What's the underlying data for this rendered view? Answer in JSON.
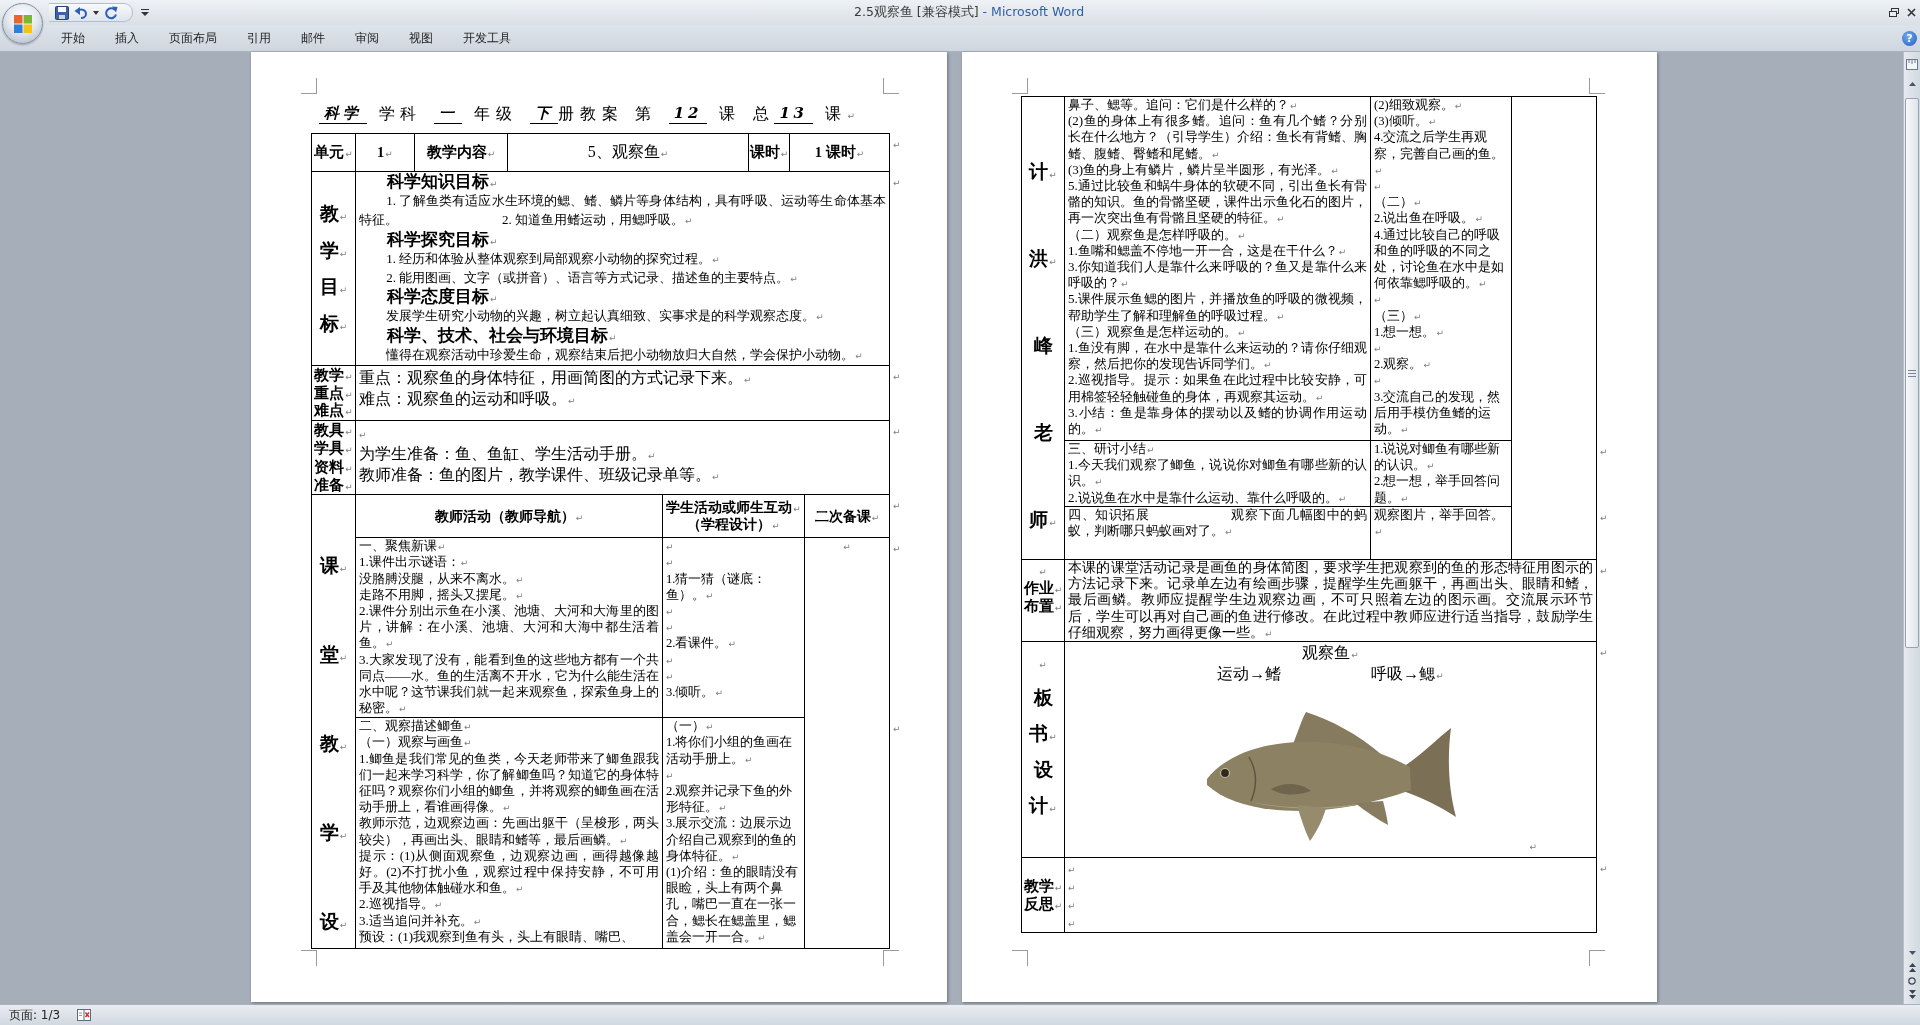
{
  "window": {
    "title": {
      "document": "2.5观察鱼 [兼容模式]",
      "separator": "-",
      "app": "Microsoft Word"
    }
  },
  "ribbon_tabs": [
    {
      "label": "开始",
      "selected": false
    },
    {
      "label": "插入",
      "selected": false
    },
    {
      "label": "页面布局",
      "selected": false
    },
    {
      "label": "引用",
      "selected": false
    },
    {
      "label": "邮件",
      "selected": false
    },
    {
      "label": "审阅",
      "selected": false
    },
    {
      "label": "视图",
      "selected": false
    },
    {
      "label": "开发工具",
      "selected": false
    }
  ],
  "help": {
    "label": "?"
  },
  "left_page": {
    "heading": [
      [
        {
          "text": "科学",
          "kind": "filled"
        }
      ],
      [
        {
          "text": "学科",
          "kind": "label"
        }
      ],
      [
        {
          "text": "一",
          "kind": "filled"
        }
      ],
      [
        {
          "text": "年级",
          "kind": "label"
        }
      ],
      [
        {
          "text": "下",
          "kind": "filled"
        },
        {
          "text": "册教案",
          "kind": "label"
        }
      ],
      [
        {
          "text": "第",
          "kind": "label"
        }
      ],
      [
        {
          "text": "12",
          "kind": "filled"
        }
      ],
      [
        {
          "text": "课",
          "kind": "label"
        }
      ],
      [
        {
          "text": "总",
          "kind": "label"
        },
        {
          "text": "13",
          "kind": "filled"
        }
      ],
      [
        {
          "text": "课",
          "kind": "label",
          "mark": "↵"
        }
      ]
    ],
    "table": {
      "info": {
        "cells": [
          {
            "text": "单元",
            "mark": "↵",
            "kind": "bold"
          },
          {
            "text": "1",
            "mark": "↵",
            "kind": "bold"
          },
          {
            "text": "教学内容",
            "mark": "↵",
            "kind": "bold"
          },
          {
            "text": "5、观察鱼",
            "mark": "↵",
            "kind": "plain"
          },
          {
            "text": "课时",
            "mark": "↵",
            "kind": "bold"
          },
          {
            "text": "1 课时",
            "mark": "↵",
            "kind": "bold"
          }
        ],
        "row_mark": "↵"
      },
      "objectives": {
        "label": [
          {
            "text": "教",
            "mark": "↵"
          },
          {
            "text": "学",
            "mark": "↵"
          },
          {
            "text": "目",
            "mark": "↵"
          },
          {
            "text": "标",
            "mark": "↵"
          }
        ],
        "content": [
          {
            "kind": "heading",
            "text": "科学知识目标",
            "mark": "↵"
          },
          {
            "kind": "body",
            "text": "1. 了解鱼类有适应水生环境的鳃、鳍、鳞片等身体结构，具有呼吸、运动等生命体基本特征。　　　　　　　　2. 知道鱼用鳍运动，用鳃呼吸。",
            "mark": "↵"
          },
          {
            "kind": "heading",
            "text": "科学探究目标",
            "mark": "↵"
          },
          {
            "kind": "body",
            "text": "1. 经历和体验从整体观察到局部观察小动物的探究过程。",
            "mark": "↵"
          },
          {
            "kind": "body",
            "text": "2. 能用图画、文字（或拼音）、语言等方式记录、描述鱼的主要特点。",
            "mark": "↵"
          },
          {
            "kind": "heading",
            "text": "科学态度目标",
            "mark": "↵"
          },
          {
            "kind": "body",
            "text": "发展学生研究小动物的兴趣，树立起认真细致、实事求是的科学观察态度。",
            "mark": "↵"
          },
          {
            "kind": "heading",
            "text": "科学、技术、社会与环境目标",
            "mark": "↵"
          },
          {
            "kind": "body",
            "text": "懂得在观察活动中珍爱生命，观察结束后把小动物放归大自然，学会保护小动物。",
            "mark": "↵"
          }
        ],
        "row_mark": "↵"
      },
      "key_points": {
        "label": [
          {
            "text": "教学",
            "mark": "↵"
          },
          {
            "text": "重点",
            "mark": "↵"
          },
          {
            "text": "难点",
            "mark": "↵"
          }
        ],
        "content": [
          {
            "text": "重点：观察鱼的身体特征，用画简图的方式记录下来。",
            "mark": "↵"
          },
          {
            "text": "难点：观察鱼的运动和呼吸。",
            "mark": "↵"
          }
        ],
        "row_mark": "↵"
      },
      "materials": {
        "label": [
          {
            "text": "教具",
            "mark": "↵"
          },
          {
            "text": "学具",
            "mark": "↵"
          },
          {
            "text": "资料",
            "mark": "↵"
          },
          {
            "text": "准备",
            "mark": "↵"
          }
        ],
        "content": [
          {
            "mark": "↵"
          },
          {
            "text": "为学生准备：鱼、鱼缸、学生活动手册。",
            "mark": "↵"
          },
          {
            "text": "教师准备：鱼的图片，教学课件、班级记录单等。",
            "mark": "↵"
          }
        ],
        "row_mark": "↵"
      },
      "activities": {
        "label": [
          {
            "text": "课",
            "mark": "↵"
          },
          {
            "text": "堂",
            "mark": "↵"
          },
          {
            "text": "教",
            "mark": "↵"
          },
          {
            "text": "学",
            "mark": "↵"
          },
          {
            "text": "设",
            "mark": "↵"
          }
        ],
        "columns": [
          [
            {
              "text": "教师活动（教师导航）",
              "mark": "↵"
            }
          ],
          [
            {
              "text": "学生活动或师生互动",
              "mark": "↵"
            },
            {
              "text": "（学程设计）",
              "mark": "↵"
            }
          ],
          [
            {
              "text": "二次备课",
              "mark": "↵"
            }
          ]
        ],
        "header_mark": "↵",
        "rows": [
          {
            "teacher": [
              {
                "text": "一、聚焦新课",
                "mark": "↵"
              },
              {
                "text": "1.课件出示谜语：",
                "mark": "↵"
              },
              {
                "text": "没胳膊没腿，从来不离水。",
                "mark": "↵"
              },
              {
                "text": "走路不用脚，摇头又摆尾。",
                "mark": "↵"
              },
              {
                "text": "2.课件分别出示鱼在小溪、池塘、大河和大海里的图片，讲解：在小溪、池塘、大河和大海中都生活着鱼。",
                "mark": "↵"
              },
              {
                "text": "3.大家发现了没有，能看到鱼的这些地方都有一个共同点——水。鱼的生活离不开水，它为什么能生活在水中呢？这节课我们就一起来观察鱼，探索鱼身上的秘密。",
                "mark": "↵"
              }
            ],
            "student": [
              {
                "mark": "↵"
              },
              {
                "mark": "↵"
              },
              {
                "text": "1.猜一猜（谜底：鱼）。",
                "mark": "↵"
              },
              {
                "mark": "↵"
              },
              {
                "mark": "↵"
              },
              {
                "text": "2.看课件。",
                "mark": "↵"
              },
              {
                "mark": "↵"
              },
              {
                "mark": "↵"
              },
              {
                "text": "3.倾听。",
                "mark": "↵"
              }
            ],
            "row_mark": "↵"
          },
          {
            "teacher": [
              {
                "text": "二、观察描述鲫鱼",
                "mark": "↵"
              },
              {
                "text": "（一）观察与画鱼",
                "mark": "↵"
              },
              {
                "text": "1.鲫鱼是我们常见的鱼类，今天老师带来了鲫鱼跟我们一起来学习科学，你了解鲫鱼吗？知道它的身体特征吗？观察你们小组的鲫鱼，并将观察的鲫鱼画在活动手册上，看谁画得像。",
                "mark": "↵"
              },
              {
                "text": "教师示范，边观察边画：先画出躯干（呈梭形，两头较尖），再画出头、眼睛和鳍等，最后画鳞。",
                "mark": "↵"
              },
              {
                "text": "提示：(1)从侧面观察鱼，边观察边画，画得越像越好。(2)不打扰小鱼，观察过程中保持安静，不可用手及其他物体触碰水和鱼。",
                "mark": "↵"
              },
              {
                "text": "2.巡视指导。",
                "mark": "↵"
              },
              {
                "text": "3.适当追问并补充。",
                "mark": "↵"
              },
              {
                "text": "预设：(1)我观察到鱼有头，头上有眼睛、嘴巴、"
              }
            ],
            "student": [
              {
                "text": "（一）",
                "mark": "↵"
              },
              {
                "text": "1.将你们小组的鱼画在活动手册上。",
                "mark": "↵"
              },
              {
                "mark": "↵"
              },
              {
                "text": "2.观察并记录下鱼的外形特征。",
                "mark": "↵"
              },
              {
                "text": "3.展示交流：边展示边介绍自己观察到的鱼的身体特征。",
                "mark": "↵"
              },
              {
                "text": "(1)介绍：鱼的眼睛没有眼睑，头上有两个鼻孔，嘴巴一直在一张一合，鳃长在鳃盖里，鳃盖会一开一合。",
                "mark": "↵"
              }
            ],
            "row_mark": "↵"
          }
        ],
        "notes": [
          {
            "mark": "↵"
          }
        ]
      }
    }
  },
  "right_page": {
    "table": {
      "activities": {
        "label": [
          {
            "text": "计",
            "mark": "↵"
          },
          {
            "text": "洪",
            "mark": "↵"
          },
          {
            "text": "峰"
          },
          {
            "text": "老"
          },
          {
            "text": "师",
            "mark": "↵"
          }
        ],
        "rows": [
          {
            "teacher": [
              {
                "text": "鼻子、鳃等。追问：它们是什么样的？",
                "mark": "↵"
              },
              {
                "text": "(2)鱼的身体上有很多鳍。追问：鱼有几个鳍？分别长在什么地方？（引导学生）介绍：鱼长有背鳍、胸鳍、腹鳍、臀鳍和尾鳍。",
                "mark": "↵"
              },
              {
                "text": "(3)鱼的身上有鳞片，鳞片呈半圆形，有光泽。",
                "mark": "↵"
              },
              {
                "text": "5.通过比较鱼和蜗牛身体的软硬不同，引出鱼长有骨骼的知识。鱼的骨骼坚硬，课件出示鱼化石的图片，再一次突出鱼有骨骼且坚硬的特征。",
                "mark": "↵"
              },
              {
                "text": "（二）观察鱼是怎样呼吸的。",
                "mark": "↵"
              },
              {
                "text": "1.鱼嘴和鳃盖不停地一开一合，这是在干什么？",
                "mark": "↵"
              },
              {
                "text": "3.你知道我们人是靠什么来呼吸的？鱼又是靠什么来呼吸的？",
                "mark": "↵"
              },
              {
                "text": "5.课件展示鱼鳃的图片，并播放鱼的呼吸的微视频，帮助学生了解和理解鱼的呼吸过程。",
                "mark": "↵"
              },
              {
                "text": "（三）观察鱼是怎样运动的。",
                "mark": "↵"
              },
              {
                "text": "1.鱼没有脚，在水中是靠什么来运动的？请你仔细观察，然后把你的发现告诉同学们。",
                "mark": "↵"
              },
              {
                "text": "2.巡视指导。提示：如果鱼在此过程中比较安静，可用棉签轻轻触碰鱼的身体，再观察其运动。",
                "mark": "↵"
              },
              {
                "text": "3.小结：鱼是靠身体的摆动以及鳍的协调作用运动的。",
                "mark": "↵"
              }
            ],
            "student": [
              {
                "text": "(2)细致观察。",
                "mark": "↵"
              },
              {
                "text": "(3)倾听。",
                "mark": "↵"
              },
              {
                "text": "4.交流之后学生再观察，完善自己画的鱼。",
                "mark": "↵"
              },
              {
                "mark": "↵"
              },
              {
                "text": "（二）",
                "mark": "↵"
              },
              {
                "text": "2.说出鱼在呼吸。",
                "mark": "↵"
              },
              {
                "text": "4.通过比较自己的呼吸和鱼的呼吸的不同之处，讨论鱼在水中是如何依靠鳃呼吸的。",
                "mark": "↵"
              },
              {
                "mark": "↵"
              },
              {
                "text": "（三）",
                "mark": "↵"
              },
              {
                "text": "1.想一想。",
                "mark": "↵"
              },
              {
                "mark": "↵"
              },
              {
                "text": "2.观察。",
                "mark": "↵"
              },
              {
                "mark": "↵"
              },
              {
                "text": "3.交流自己的发现，然后用手模仿鱼鳍的运动。",
                "mark": "↵"
              }
            ]
          },
          {
            "teacher": [
              {
                "text": "三、研讨小结",
                "mark": "↵"
              },
              {
                "text": "1.今天我们观察了鲫鱼，说说你对鲫鱼有哪些新的认识。",
                "mark": "↵"
              },
              {
                "text": "2.说说鱼在水中是靠什么运动、靠什么呼吸的。",
                "mark": "↵"
              }
            ],
            "student": [
              {
                "text": "1.说说对鲫鱼有哪些新的认识。",
                "mark": "↵"
              },
              {
                "text": "2.想一想，举手回答问题。",
                "mark": "↵"
              }
            ],
            "row_mark": "↵"
          },
          {
            "teacher": [
              {
                "text": "四、知识拓展　　　　　　观察下面几幅图中的蚂蚁，判断哪只蚂蚁画对了。",
                "mark": "↵"
              }
            ],
            "student": [
              {
                "text": "观察图片，举手回答。",
                "mark": "↵"
              }
            ],
            "row_mark": "↵"
          }
        ]
      },
      "homework": {
        "label": [
          {
            "mark": "↵"
          },
          {
            "text": "作业",
            "mark": "↵"
          },
          {
            "text": "布置",
            "mark": "↵"
          }
        ],
        "content": [
          {
            "text": "本课的课堂活动记录是画鱼的身体简图，要求学生把观察到的鱼的形态特征用图示的方法记录下来。记录单左边有绘画步骤，提醒学生先画躯干，再画出头、眼睛和鳍，最后画鳞。教师应提醒学生边观察边画，不可只照着左边的图示画。交流展示环节后，学生可以再对自己画的鱼进行修改。在此过程中教师应进行适当指导，鼓励学生仔细观察，努力画得更像一些。",
            "mark": "↵"
          }
        ],
        "row_mark": "↵"
      },
      "board": {
        "label": [
          {
            "mark": "↵"
          },
          {
            "text": "板"
          },
          {
            "text": "书",
            "mark": "↵"
          },
          {
            "text": "设"
          },
          {
            "text": "计",
            "mark": "↵"
          }
        ],
        "title": {
          "text": "观察鱼",
          "mark": "↵"
        },
        "terms": [
          {
            "text": "运动→鳍"
          },
          {
            "text": "呼吸→鳃",
            "mark": "↵"
          }
        ],
        "photo_mark": "↵",
        "row_mark": "↵"
      },
      "reflection": {
        "label": [
          {
            "text": "教学",
            "mark": "↵"
          },
          {
            "text": "反思",
            "mark": "↵"
          }
        ],
        "content": [
          {
            "mark": "↵"
          },
          {
            "mark": "↵"
          },
          {
            "mark": "↵"
          },
          {
            "mark": "↵"
          }
        ],
        "row_mark": "↵"
      }
    }
  },
  "status_bar": {
    "page": "页面: 1/3"
  }
}
